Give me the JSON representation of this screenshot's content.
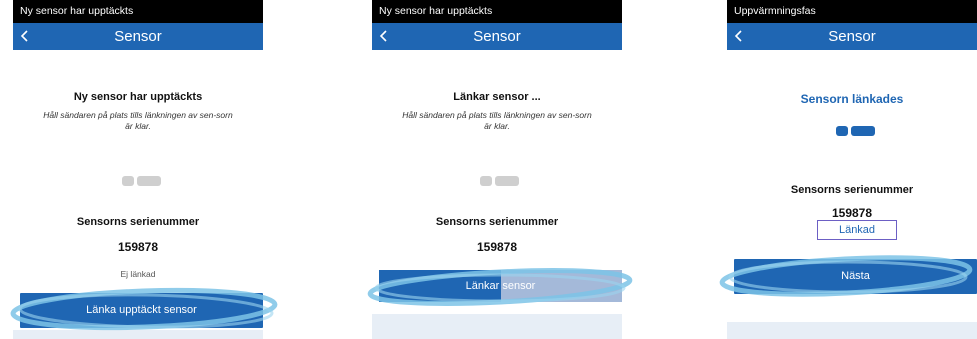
{
  "colors": {
    "brand_blue": "#1f66b3",
    "status_bar": "#000000",
    "highlight": "#7cc3e6",
    "progress_track": "#a4b9d9"
  },
  "screens": [
    {
      "status_bar": "Ny sensor har upptäckts",
      "nav_title": "Sensor",
      "heading": "Ny sensor har upptäckts",
      "hint": "Håll sändaren på plats tills länkningen av sen-sorn är klar.",
      "serial_label": "Sensorns serienummer",
      "serial": "159878",
      "link_status": "Ej länkad",
      "button": "Länka upptäckt sensor"
    },
    {
      "status_bar": "Ny sensor har upptäckts",
      "nav_title": "Sensor",
      "heading": "Länkar sensor ...",
      "hint": "Håll sändaren på plats tills länkningen av sen-sorn är klar.",
      "serial_label": "Sensorns serienummer",
      "serial": "159878",
      "button": "Länkar sensor",
      "progress": 0.5
    },
    {
      "status_bar": "Uppvärmningsfas",
      "nav_title": "Sensor",
      "heading": "Sensorn länkades",
      "serial_label": "Sensorns serienummer",
      "serial": "159878",
      "link_status": "Länkad",
      "button": "Nästa"
    }
  ]
}
